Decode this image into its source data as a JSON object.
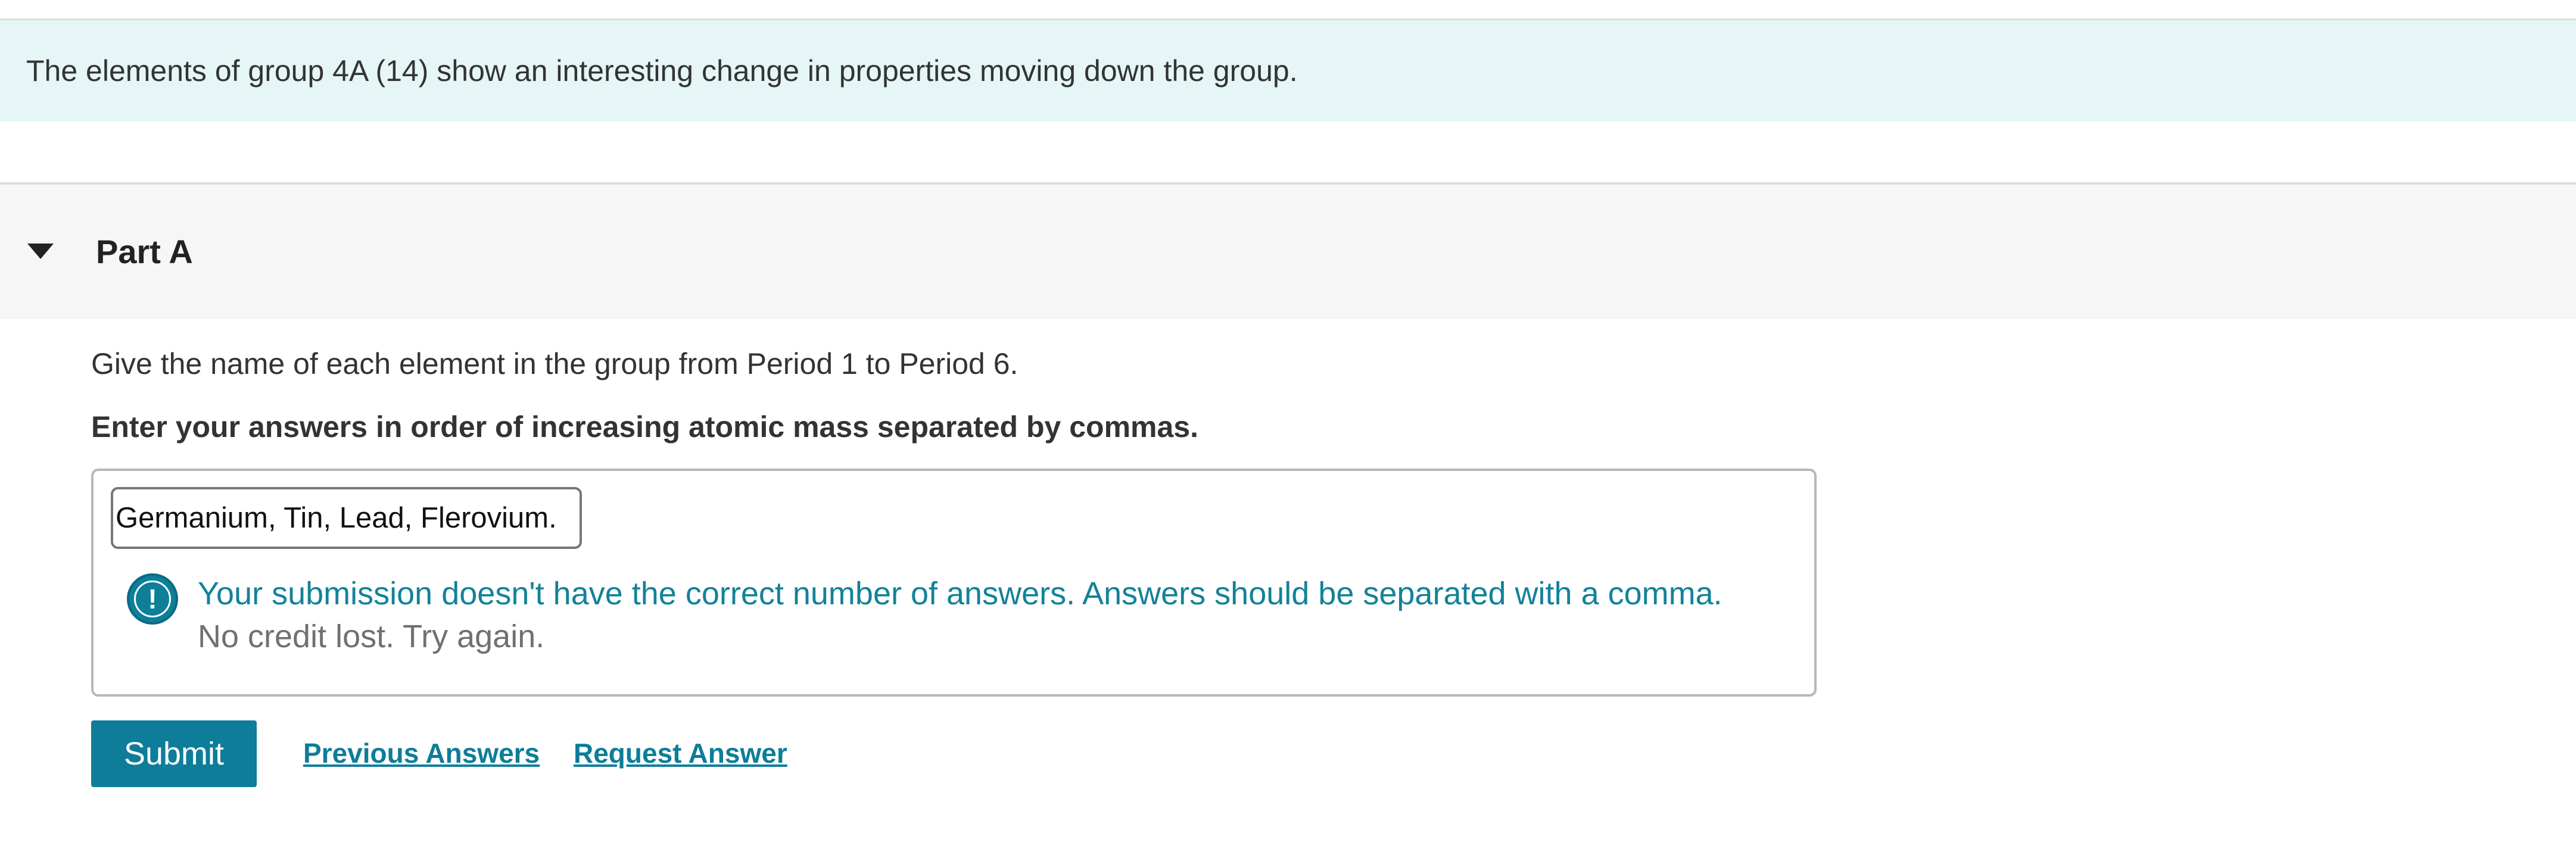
{
  "intro": {
    "text": "The elements of group 4A (14) show an interesting change in properties moving down the group."
  },
  "part": {
    "title": "Part A",
    "icon": "chevron-down-icon"
  },
  "question": {
    "text": "Give the name of each element in the group from Period 1 to Period 6.",
    "instruction": "Enter your answers in order of increasing atomic mass separated by commas."
  },
  "answer": {
    "value": "Germanium, Tin, Lead, Flerovium."
  },
  "feedback": {
    "icon": "alert-icon",
    "message": "Your submission doesn't have the correct number of answers. Answers should be separated with a comma.",
    "note": "No credit lost. Try again."
  },
  "actions": {
    "submit_label": "Submit",
    "previous_answers_label": "Previous Answers",
    "request_answer_label": "Request Answer"
  },
  "colors": {
    "accent": "#0d7d99",
    "banner_bg": "#e6f5f5",
    "feedback_text": "#12829a"
  }
}
